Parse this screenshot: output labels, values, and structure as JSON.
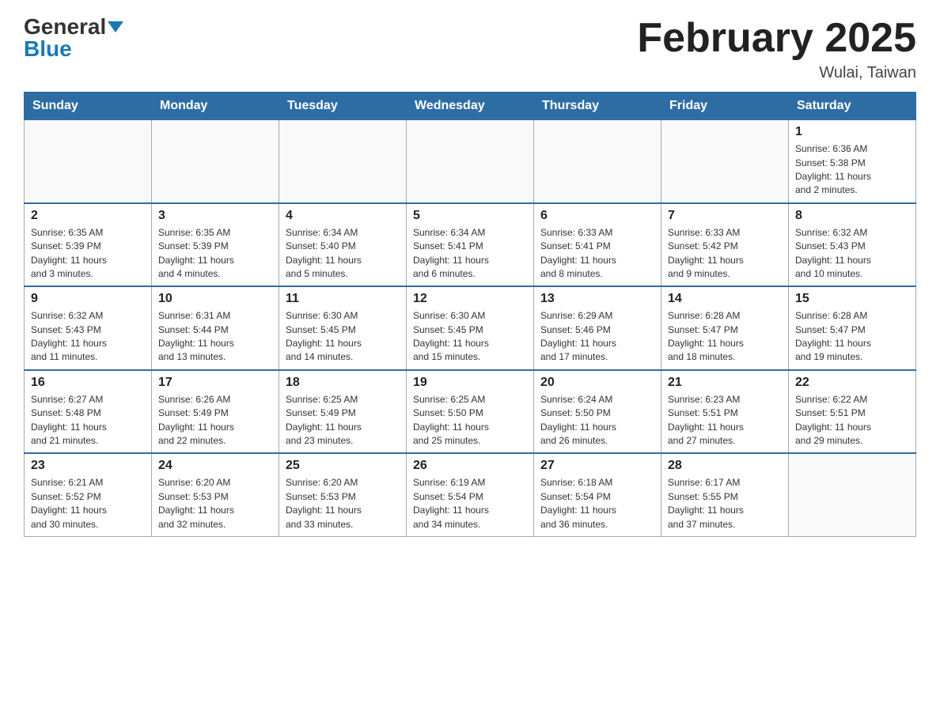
{
  "logo": {
    "general": "General",
    "blue": "Blue"
  },
  "title": "February 2025",
  "location": "Wulai, Taiwan",
  "days_of_week": [
    "Sunday",
    "Monday",
    "Tuesday",
    "Wednesday",
    "Thursday",
    "Friday",
    "Saturday"
  ],
  "weeks": [
    [
      {
        "day": "",
        "info": ""
      },
      {
        "day": "",
        "info": ""
      },
      {
        "day": "",
        "info": ""
      },
      {
        "day": "",
        "info": ""
      },
      {
        "day": "",
        "info": ""
      },
      {
        "day": "",
        "info": ""
      },
      {
        "day": "1",
        "info": "Sunrise: 6:36 AM\nSunset: 5:38 PM\nDaylight: 11 hours\nand 2 minutes."
      }
    ],
    [
      {
        "day": "2",
        "info": "Sunrise: 6:35 AM\nSunset: 5:39 PM\nDaylight: 11 hours\nand 3 minutes."
      },
      {
        "day": "3",
        "info": "Sunrise: 6:35 AM\nSunset: 5:39 PM\nDaylight: 11 hours\nand 4 minutes."
      },
      {
        "day": "4",
        "info": "Sunrise: 6:34 AM\nSunset: 5:40 PM\nDaylight: 11 hours\nand 5 minutes."
      },
      {
        "day": "5",
        "info": "Sunrise: 6:34 AM\nSunset: 5:41 PM\nDaylight: 11 hours\nand 6 minutes."
      },
      {
        "day": "6",
        "info": "Sunrise: 6:33 AM\nSunset: 5:41 PM\nDaylight: 11 hours\nand 8 minutes."
      },
      {
        "day": "7",
        "info": "Sunrise: 6:33 AM\nSunset: 5:42 PM\nDaylight: 11 hours\nand 9 minutes."
      },
      {
        "day": "8",
        "info": "Sunrise: 6:32 AM\nSunset: 5:43 PM\nDaylight: 11 hours\nand 10 minutes."
      }
    ],
    [
      {
        "day": "9",
        "info": "Sunrise: 6:32 AM\nSunset: 5:43 PM\nDaylight: 11 hours\nand 11 minutes."
      },
      {
        "day": "10",
        "info": "Sunrise: 6:31 AM\nSunset: 5:44 PM\nDaylight: 11 hours\nand 13 minutes."
      },
      {
        "day": "11",
        "info": "Sunrise: 6:30 AM\nSunset: 5:45 PM\nDaylight: 11 hours\nand 14 minutes."
      },
      {
        "day": "12",
        "info": "Sunrise: 6:30 AM\nSunset: 5:45 PM\nDaylight: 11 hours\nand 15 minutes."
      },
      {
        "day": "13",
        "info": "Sunrise: 6:29 AM\nSunset: 5:46 PM\nDaylight: 11 hours\nand 17 minutes."
      },
      {
        "day": "14",
        "info": "Sunrise: 6:28 AM\nSunset: 5:47 PM\nDaylight: 11 hours\nand 18 minutes."
      },
      {
        "day": "15",
        "info": "Sunrise: 6:28 AM\nSunset: 5:47 PM\nDaylight: 11 hours\nand 19 minutes."
      }
    ],
    [
      {
        "day": "16",
        "info": "Sunrise: 6:27 AM\nSunset: 5:48 PM\nDaylight: 11 hours\nand 21 minutes."
      },
      {
        "day": "17",
        "info": "Sunrise: 6:26 AM\nSunset: 5:49 PM\nDaylight: 11 hours\nand 22 minutes."
      },
      {
        "day": "18",
        "info": "Sunrise: 6:25 AM\nSunset: 5:49 PM\nDaylight: 11 hours\nand 23 minutes."
      },
      {
        "day": "19",
        "info": "Sunrise: 6:25 AM\nSunset: 5:50 PM\nDaylight: 11 hours\nand 25 minutes."
      },
      {
        "day": "20",
        "info": "Sunrise: 6:24 AM\nSunset: 5:50 PM\nDaylight: 11 hours\nand 26 minutes."
      },
      {
        "day": "21",
        "info": "Sunrise: 6:23 AM\nSunset: 5:51 PM\nDaylight: 11 hours\nand 27 minutes."
      },
      {
        "day": "22",
        "info": "Sunrise: 6:22 AM\nSunset: 5:51 PM\nDaylight: 11 hours\nand 29 minutes."
      }
    ],
    [
      {
        "day": "23",
        "info": "Sunrise: 6:21 AM\nSunset: 5:52 PM\nDaylight: 11 hours\nand 30 minutes."
      },
      {
        "day": "24",
        "info": "Sunrise: 6:20 AM\nSunset: 5:53 PM\nDaylight: 11 hours\nand 32 minutes."
      },
      {
        "day": "25",
        "info": "Sunrise: 6:20 AM\nSunset: 5:53 PM\nDaylight: 11 hours\nand 33 minutes."
      },
      {
        "day": "26",
        "info": "Sunrise: 6:19 AM\nSunset: 5:54 PM\nDaylight: 11 hours\nand 34 minutes."
      },
      {
        "day": "27",
        "info": "Sunrise: 6:18 AM\nSunset: 5:54 PM\nDaylight: 11 hours\nand 36 minutes."
      },
      {
        "day": "28",
        "info": "Sunrise: 6:17 AM\nSunset: 5:55 PM\nDaylight: 11 hours\nand 37 minutes."
      },
      {
        "day": "",
        "info": ""
      }
    ]
  ]
}
